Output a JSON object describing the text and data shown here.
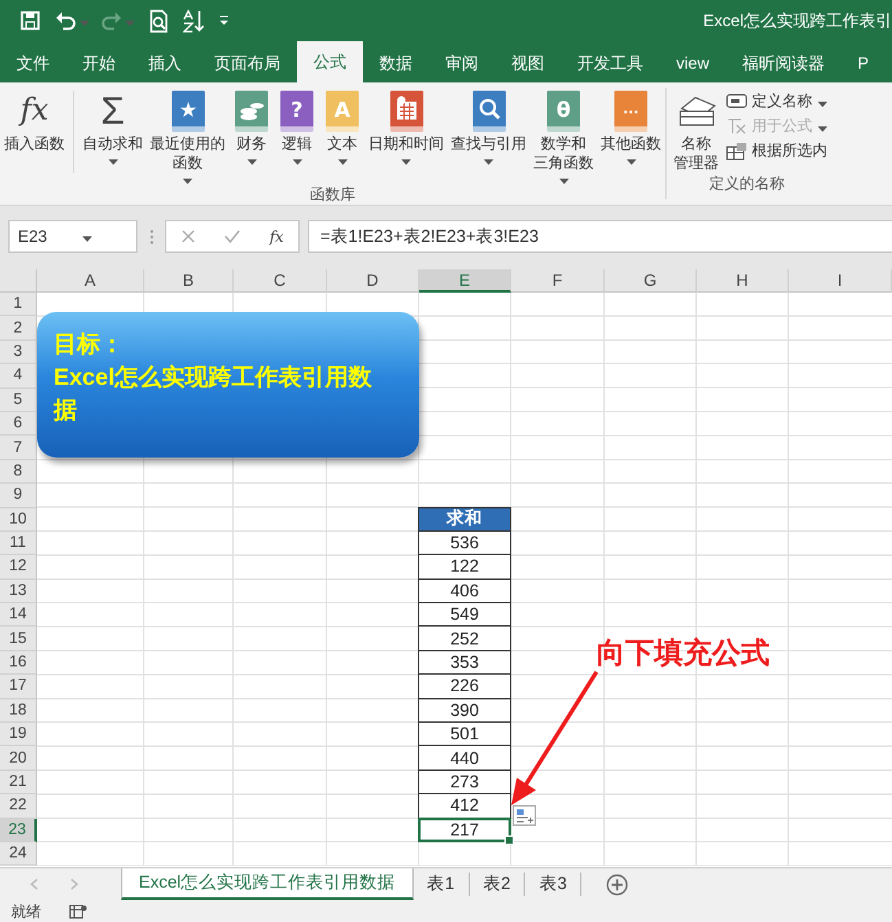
{
  "window": {
    "title": "Excel怎么实现跨工作表引"
  },
  "ribbon_tabs": [
    {
      "label": "文件",
      "selected": false
    },
    {
      "label": "开始",
      "selected": false
    },
    {
      "label": "插入",
      "selected": false
    },
    {
      "label": "页面布局",
      "selected": false
    },
    {
      "label": "公式",
      "selected": true
    },
    {
      "label": "数据",
      "selected": false
    },
    {
      "label": "审阅",
      "selected": false
    },
    {
      "label": "视图",
      "selected": false
    },
    {
      "label": "开发工具",
      "selected": false
    },
    {
      "label": "view",
      "selected": false
    },
    {
      "label": "福昕阅读器",
      "selected": false
    },
    {
      "label": "P",
      "selected": false
    }
  ],
  "function_library": {
    "label": "函数库",
    "buttons": [
      {
        "kind": "fx",
        "glyph": "fx",
        "lines": [
          "插入函数"
        ],
        "dropdown": false
      },
      {
        "kind": "sigma",
        "glyph": "Σ",
        "lines": [
          "自动求和"
        ],
        "dropdown": true
      },
      {
        "kind": "book",
        "glyph": "★",
        "color": "#3d7ec1",
        "lines": [
          "最近使用的",
          "函数"
        ],
        "dropdown": true
      },
      {
        "kind": "coins",
        "color": "#5f9e87",
        "lines": [
          "财务"
        ],
        "dropdown": true
      },
      {
        "kind": "book",
        "glyph": "?",
        "color": "#8b5fbf",
        "lines": [
          "逻辑"
        ],
        "dropdown": true
      },
      {
        "kind": "book",
        "glyph": "A",
        "color": "#f0c060",
        "lines": [
          "文本"
        ],
        "dropdown": true
      },
      {
        "kind": "calendar",
        "color": "#d6553a",
        "lines": [
          "日期和时间"
        ],
        "dropdown": true
      },
      {
        "kind": "search",
        "color": "#3d7ec1",
        "lines": [
          "查找与引用"
        ],
        "dropdown": true
      },
      {
        "kind": "book",
        "glyph": "θ",
        "color": "#5f9e87",
        "lines": [
          "数学和",
          "三角函数"
        ],
        "dropdown": true
      },
      {
        "kind": "book",
        "glyph": "···",
        "color": "#e8843a",
        "lines": [
          "其他函数"
        ],
        "dropdown": true
      }
    ]
  },
  "defined_names": {
    "label": "定义的名称",
    "manager": {
      "lines": [
        "名称",
        "管理器"
      ]
    },
    "items": [
      {
        "kind": "tag",
        "label": "定义名称",
        "dropdown": true,
        "disabled": false
      },
      {
        "kind": "formula",
        "label": "用于公式",
        "dropdown": true,
        "disabled": true
      },
      {
        "kind": "grid",
        "label": "根据所选内",
        "dropdown": false,
        "disabled": false
      }
    ]
  },
  "formula_bar": {
    "name_box": "E23",
    "fx_label": "fx",
    "formula": "=表1!E23+表2!E23+表3!E23"
  },
  "columns": [
    {
      "label": "A",
      "selected": false
    },
    {
      "label": "B",
      "selected": false
    },
    {
      "label": "C",
      "selected": false
    },
    {
      "label": "D",
      "selected": false
    },
    {
      "label": "E",
      "selected": true
    },
    {
      "label": "F",
      "selected": false
    },
    {
      "label": "G",
      "selected": false
    },
    {
      "label": "H",
      "selected": false
    },
    {
      "label": "I",
      "selected": false
    }
  ],
  "rows": [
    {
      "label": "1",
      "selected": false
    },
    {
      "label": "2",
      "selected": false
    },
    {
      "label": "3",
      "selected": false
    },
    {
      "label": "4",
      "selected": false
    },
    {
      "label": "5",
      "selected": false
    },
    {
      "label": "6",
      "selected": false
    },
    {
      "label": "7",
      "selected": false
    },
    {
      "label": "8",
      "selected": false
    },
    {
      "label": "9",
      "selected": false
    },
    {
      "label": "10",
      "selected": false
    },
    {
      "label": "11",
      "selected": false
    },
    {
      "label": "12",
      "selected": false
    },
    {
      "label": "13",
      "selected": false
    },
    {
      "label": "14",
      "selected": false
    },
    {
      "label": "15",
      "selected": false
    },
    {
      "label": "16",
      "selected": false
    },
    {
      "label": "17",
      "selected": false
    },
    {
      "label": "18",
      "selected": false
    },
    {
      "label": "19",
      "selected": false
    },
    {
      "label": "20",
      "selected": false
    },
    {
      "label": "21",
      "selected": false
    },
    {
      "label": "22",
      "selected": false
    },
    {
      "label": "23",
      "selected": true
    },
    {
      "label": "24",
      "selected": false
    }
  ],
  "sum_table": {
    "header": "求和",
    "values": [
      {
        "text": "536",
        "selected": false
      },
      {
        "text": "122",
        "selected": false
      },
      {
        "text": "406",
        "selected": false
      },
      {
        "text": "549",
        "selected": false
      },
      {
        "text": "252",
        "selected": false
      },
      {
        "text": "353",
        "selected": false
      },
      {
        "text": "226",
        "selected": false
      },
      {
        "text": "390",
        "selected": false
      },
      {
        "text": "501",
        "selected": false
      },
      {
        "text": "440",
        "selected": false
      },
      {
        "text": "273",
        "selected": false
      },
      {
        "text": "412",
        "selected": false
      },
      {
        "text": "217",
        "selected": true
      }
    ]
  },
  "callout": {
    "title": "目标：",
    "body": "Excel怎么实现跨工作表引用数据"
  },
  "annotation": {
    "text": "向下填充公式"
  },
  "sheet_tabs": [
    {
      "label": "Excel怎么实现跨工作表引用数据",
      "selected": true
    },
    {
      "label": "表1",
      "selected": false
    },
    {
      "label": "表2",
      "selected": false
    },
    {
      "label": "表3",
      "selected": false
    }
  ],
  "status_bar": {
    "text": "就绪"
  }
}
